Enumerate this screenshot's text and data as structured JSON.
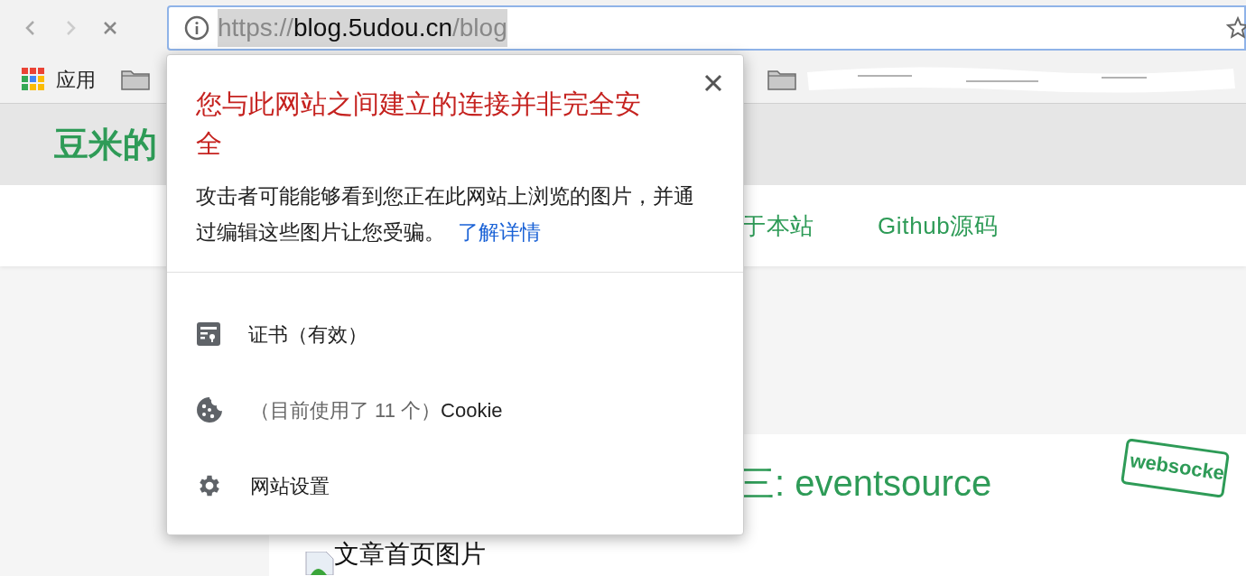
{
  "address_bar": {
    "scheme": "https://",
    "host": "blog.5udou.cn",
    "path": "/blog",
    "selected": true
  },
  "bookmarks": [
    {
      "kind": "apps",
      "label": "应用"
    },
    {
      "kind": "folder"
    },
    {
      "kind": "hidden_folder"
    }
  ],
  "page": {
    "site_title": "豆米的",
    "nav": [
      "于本站",
      "Github源码"
    ],
    "post_title": "三: eventsource",
    "stamp": "websocke",
    "image_alt": "文章首页图片"
  },
  "popup": {
    "title": "您与此网站之间建立的连接并非完全安全",
    "description": "攻击者可能能够看到您正在此网站上浏览的图片，并通过编辑这些图片让您受骗。",
    "link": "了解详情",
    "items": [
      {
        "kind": "certificate",
        "label": "证书（有效）"
      },
      {
        "kind": "cookies",
        "note": "（目前使用了 11 个）",
        "label": "Cookie"
      },
      {
        "kind": "settings",
        "label": "网站设置"
      }
    ]
  }
}
